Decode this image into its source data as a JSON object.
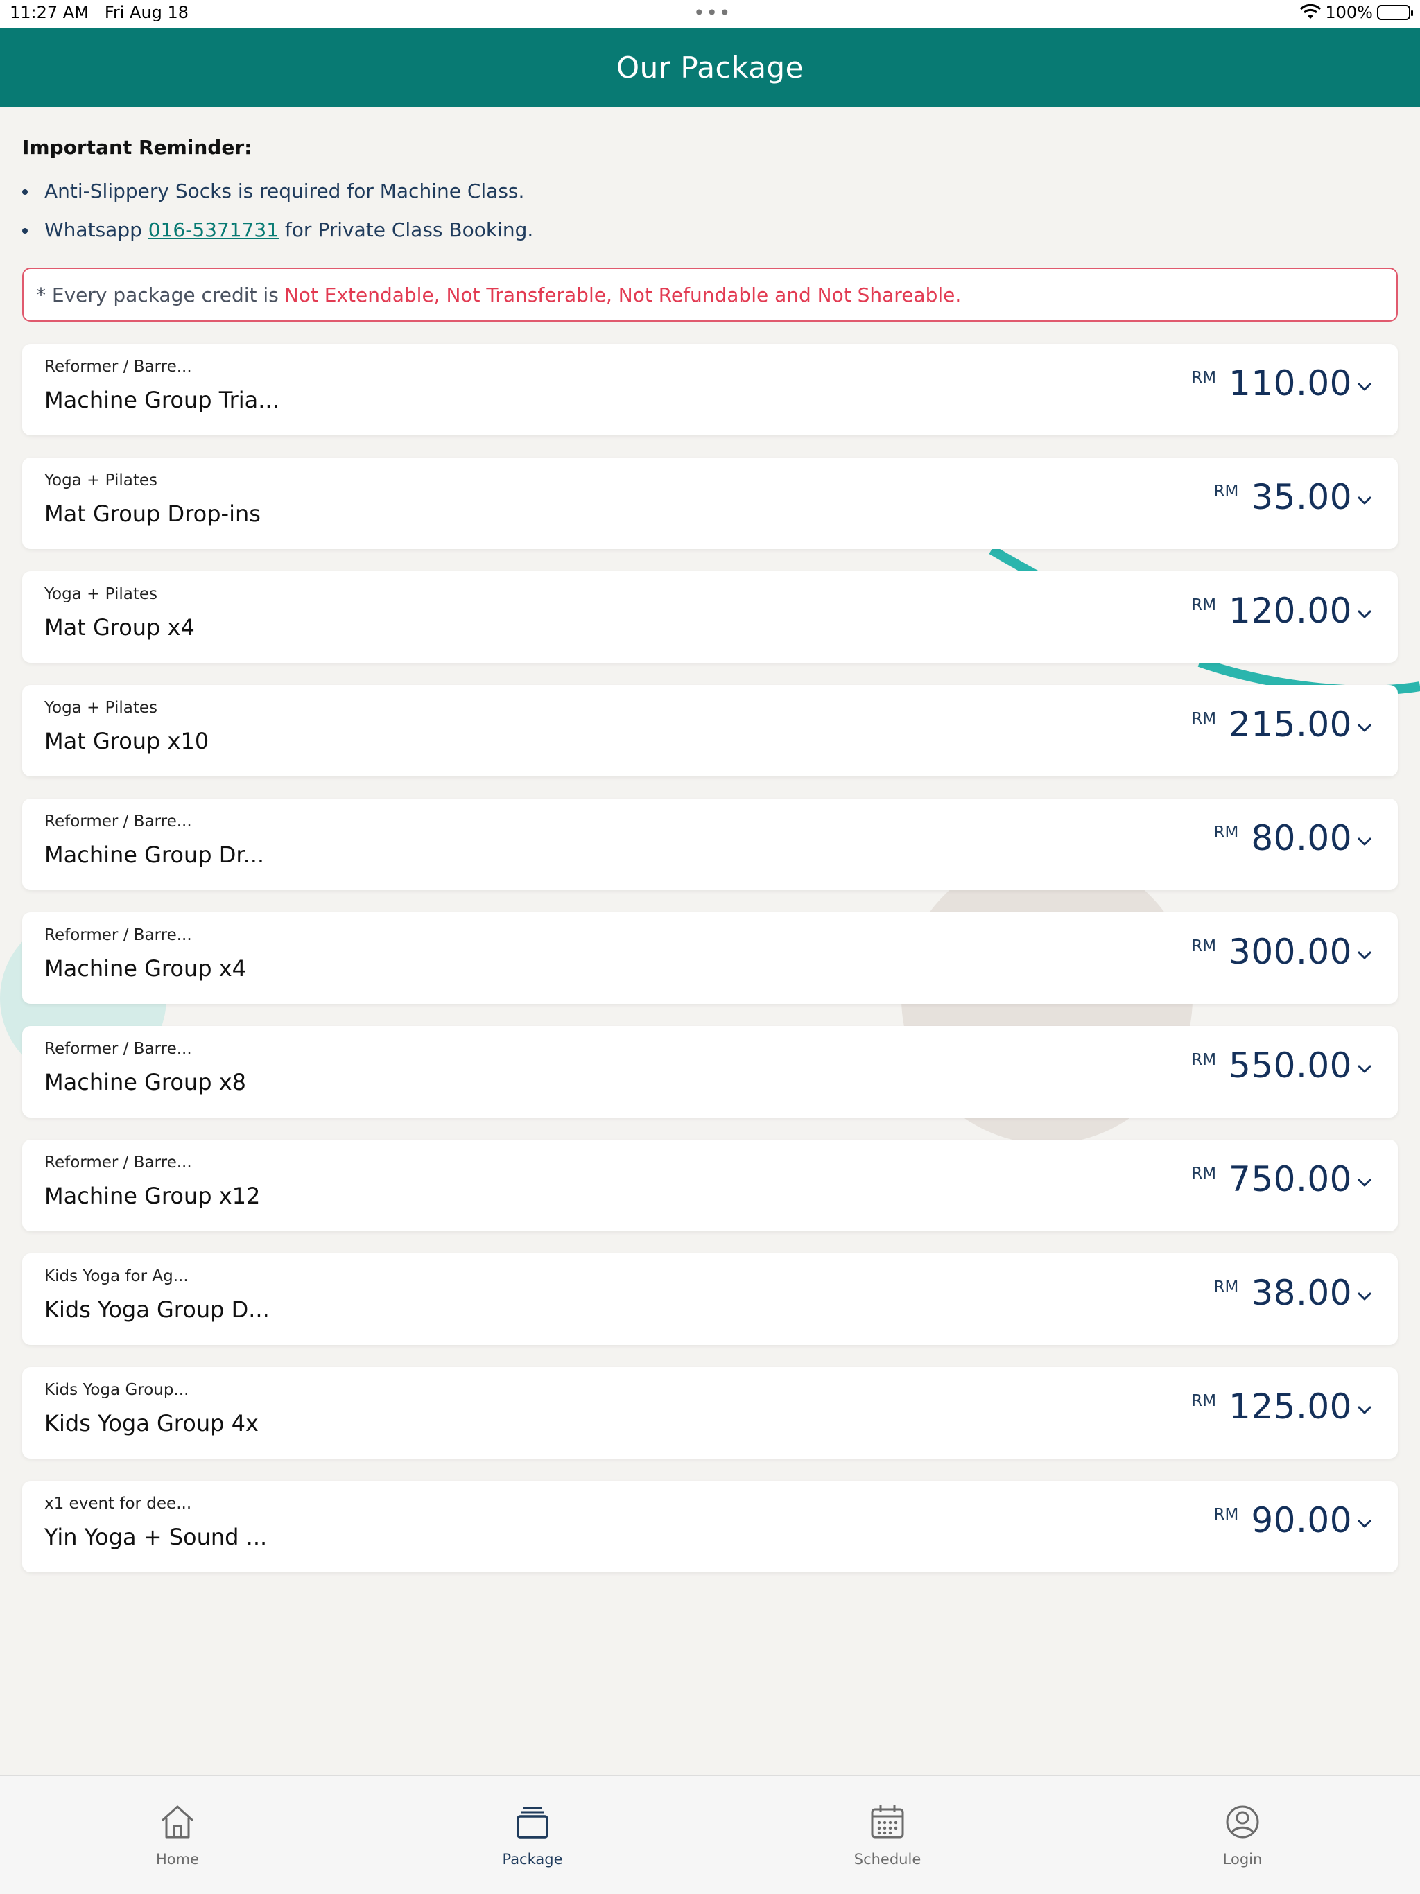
{
  "status_bar": {
    "time": "11:27 AM",
    "date": "Fri Aug 18",
    "dots": "•••",
    "battery": "100%"
  },
  "header": {
    "title": "Our Package"
  },
  "reminder": {
    "title": "Important Reminder:",
    "item1": "Anti-Slippery Socks is required for Machine Class.",
    "item2_prefix": "Whatsapp ",
    "item2_link": "016-5371731",
    "item2_suffix": " for Private Class Booking."
  },
  "notice": {
    "prefix": "* Every package credit is",
    "emphasis": "Not Extendable, Not Transferable, Not Refundable and Not Shareable."
  },
  "currency": "RM",
  "packages": [
    {
      "category": "Reformer / Barre...",
      "name": "Machine Group Tria...",
      "price": "110.00"
    },
    {
      "category": "Yoga + Pilates",
      "name": "Mat Group Drop-ins",
      "price": "35.00"
    },
    {
      "category": "Yoga + Pilates",
      "name": "Mat Group x4",
      "price": "120.00"
    },
    {
      "category": "Yoga + Pilates",
      "name": "Mat Group x10",
      "price": "215.00"
    },
    {
      "category": "Reformer / Barre...",
      "name": "Machine Group Dr...",
      "price": "80.00"
    },
    {
      "category": "Reformer / Barre...",
      "name": "Machine Group x4",
      "price": "300.00"
    },
    {
      "category": "Reformer / Barre...",
      "name": "Machine Group x8",
      "price": "550.00"
    },
    {
      "category": "Reformer / Barre...",
      "name": "Machine Group x12",
      "price": "750.00"
    },
    {
      "category": "Kids Yoga for Ag...",
      "name": "Kids Yoga Group D...",
      "price": "38.00"
    },
    {
      "category": "Kids Yoga Group...",
      "name": "Kids Yoga Group 4x",
      "price": "125.00"
    },
    {
      "category": "x1 event for dee...",
      "name": "Yin Yoga + Sound ...",
      "price": "90.00"
    }
  ],
  "tabs": [
    {
      "label": "Home",
      "icon": "home-icon"
    },
    {
      "label": "Package",
      "icon": "package-icon"
    },
    {
      "label": "Schedule",
      "icon": "calendar-icon"
    },
    {
      "label": "Login",
      "icon": "user-icon"
    }
  ],
  "colors": {
    "header_bg": "#087a73",
    "price": "#14305a",
    "notice_red": "#e23b52",
    "link": "#087a73"
  }
}
